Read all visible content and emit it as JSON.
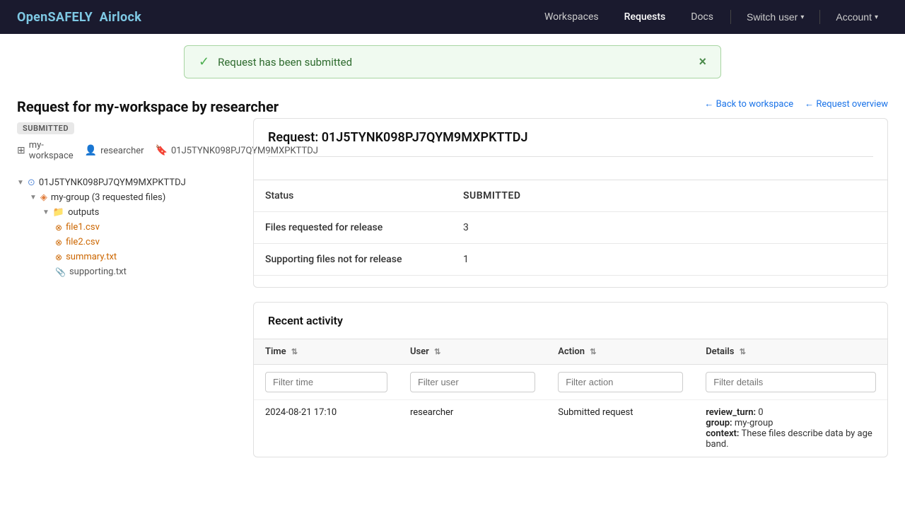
{
  "brand": {
    "part1": "OpenSAFELY",
    "part2": "Airlock"
  },
  "nav": {
    "workspaces": "Workspaces",
    "requests": "Requests",
    "docs": "Docs",
    "switch_user": "Switch user",
    "account": "Account"
  },
  "notification": {
    "message": "Request has been submitted",
    "close_label": "×"
  },
  "page": {
    "title_prefix": "Request for my-workspace by researcher",
    "status_badge": "SUBMITTED",
    "back_workspace": "← Back to workspace",
    "request_overview": "← Request overview",
    "workspace": "my-workspace",
    "researcher": "researcher",
    "request_id": "01J5TYNK098PJ7QYM9MXPKTTDJ"
  },
  "tree": {
    "root_id": "01J5TYNK098PJ7QYM9MXPKTTDJ",
    "group_label": "my-group (3 requested files)",
    "folder_label": "outputs",
    "files": [
      {
        "name": "file1.csv",
        "highlighted": true
      },
      {
        "name": "file2.csv",
        "highlighted": true
      },
      {
        "name": "summary.txt",
        "highlighted": true
      },
      {
        "name": "supporting.txt",
        "highlighted": false
      }
    ]
  },
  "request_detail": {
    "title": "Request: 01J5TYNK098PJ7QYM9MXPKTTDJ",
    "status_label": "Status",
    "status_value": "SUBMITTED",
    "files_label": "Files requested for release",
    "files_value": "3",
    "supporting_label": "Supporting files not for release",
    "supporting_value": "1"
  },
  "activity": {
    "section_title": "Recent activity",
    "columns": [
      {
        "label": "Time",
        "key": "time"
      },
      {
        "label": "User",
        "key": "user"
      },
      {
        "label": "Action",
        "key": "action"
      },
      {
        "label": "Details",
        "key": "details"
      }
    ],
    "filters": {
      "time": "Filter time",
      "user": "Filter user",
      "action": "Filter action",
      "details": "Filter details"
    },
    "rows": [
      {
        "time": "2024-08-21 17:10",
        "user": "researcher",
        "action": "Submitted request",
        "detail_key1": "review_turn:",
        "detail_val1": "0",
        "detail_key2": "group:",
        "detail_val2": "my-group",
        "detail_key3": "context:",
        "detail_val3": "These files describe data by age band."
      }
    ]
  }
}
